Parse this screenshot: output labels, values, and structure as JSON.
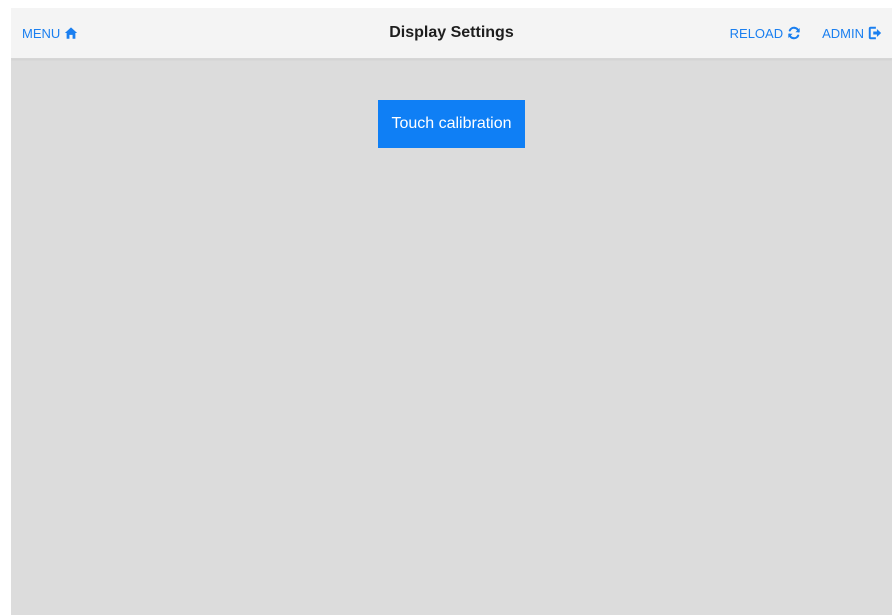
{
  "header": {
    "title": "Display Settings",
    "menu": {
      "label": "MENU",
      "icon": "home-icon"
    },
    "reload": {
      "label": "RELOAD",
      "icon": "refresh-icon"
    },
    "admin": {
      "label": "ADMIN",
      "icon": "logout-icon"
    }
  },
  "main": {
    "touch_calibration_label": "Touch calibration"
  },
  "colors": {
    "accent": "#1a7ff0",
    "button_bg": "#0f7ff5",
    "content_bg": "#dcdcdc",
    "header_bg": "#f4f4f4"
  }
}
